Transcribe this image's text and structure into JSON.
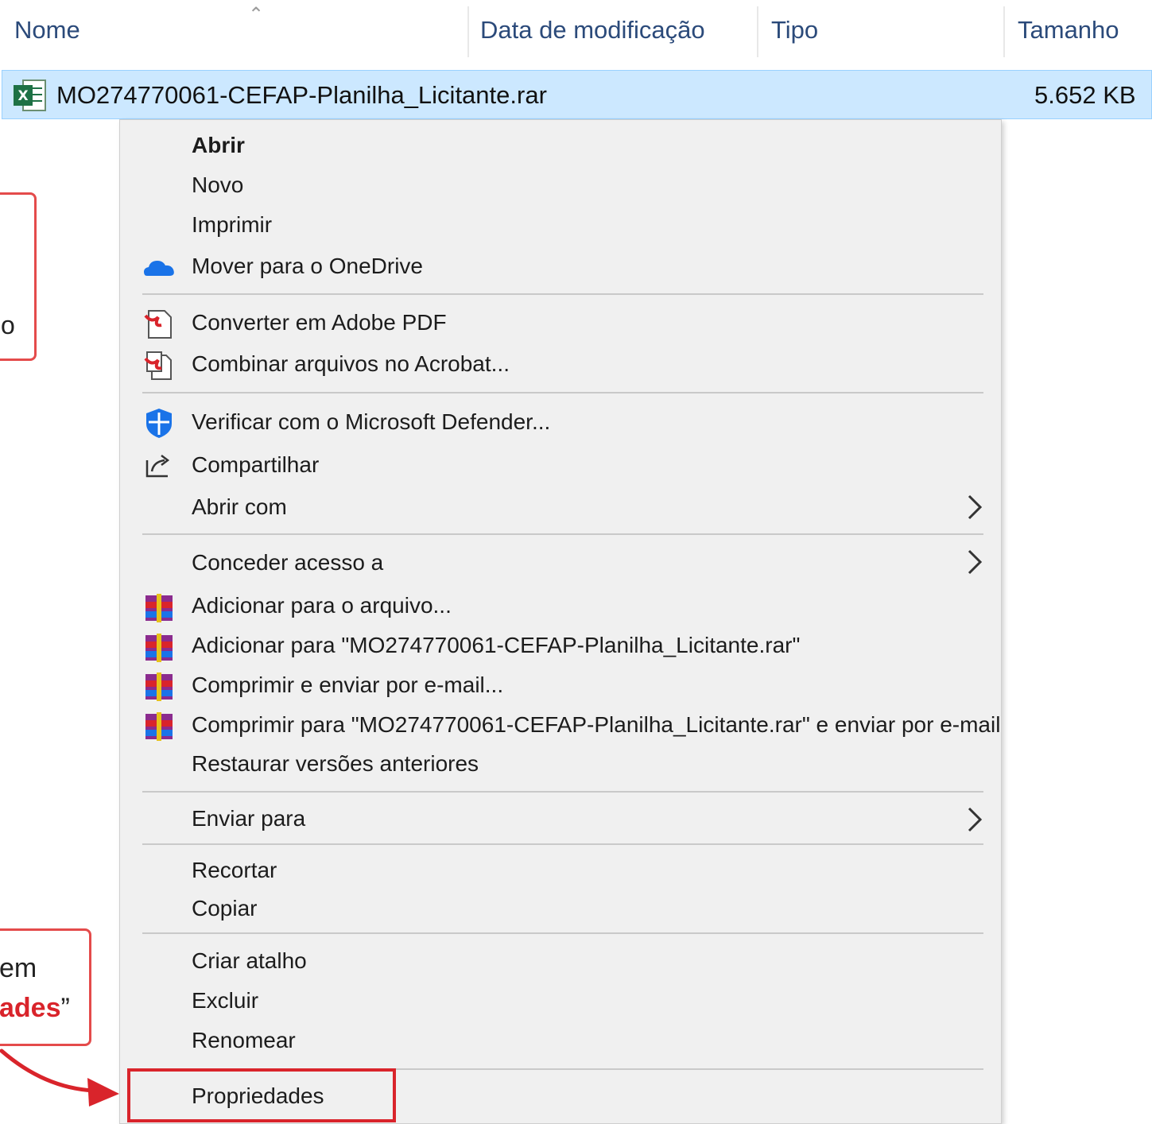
{
  "columns": {
    "name": "Nome",
    "modified": "Data de modificação",
    "type": "Tipo",
    "size": "Tamanho"
  },
  "file": {
    "name": "MO274770061-CEFAP-Planilha_Licitante.rar",
    "size": "5.652 KB",
    "icon": "excel-file-icon"
  },
  "menu": {
    "open": "Abrir",
    "new": "Novo",
    "print": "Imprimir",
    "onedrive": "Mover para o OneDrive",
    "convert_pdf": "Converter em Adobe PDF",
    "combine_acrobat": "Combinar arquivos no Acrobat...",
    "defender": "Verificar com o Microsoft Defender...",
    "share": "Compartilhar",
    "open_with": "Abrir com",
    "grant_access": "Conceder acesso a",
    "add_archive": "Adicionar para o arquivo...",
    "add_to_rar": "Adicionar para \"MO274770061-CEFAP-Planilha_Licitante.rar\"",
    "compress_email": "Comprimir e enviar por e-mail...",
    "compress_rar_email": "Comprimir para \"MO274770061-CEFAP-Planilha_Licitante.rar\" e enviar por e-mail",
    "restore_versions": "Restaurar versões anteriores",
    "send_to": "Enviar para",
    "cut": "Recortar",
    "copy": "Copiar",
    "create_shortcut": "Criar atalho",
    "delete": "Excluir",
    "rename": "Renomear",
    "properties": "Propriedades"
  },
  "callouts": {
    "top_fragment": "o",
    "bottom_line1": "em",
    "bottom_line2_highlight": "ades",
    "bottom_line2_quote": "”"
  },
  "colors": {
    "selection": "#cce8ff",
    "highlight_red": "#d9242b",
    "header_text": "#2b4a7a"
  }
}
